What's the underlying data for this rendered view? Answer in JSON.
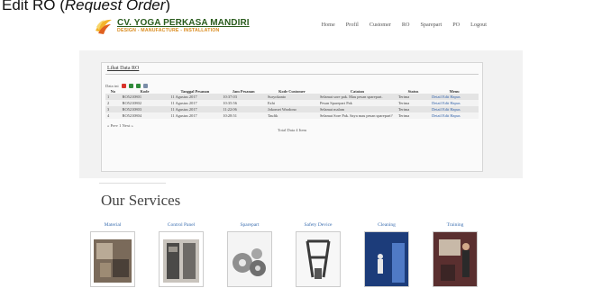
{
  "caption": {
    "prefix": "Edit RO (",
    "emphasis": "Request Order",
    "suffix": ")"
  },
  "header": {
    "company": "CV. YOGA PERKASA MANDIRI",
    "tagline": "DESIGN - MANUFACTURE - INSTALLATION",
    "nav": [
      "Home",
      "Profil",
      "Customer",
      "RO",
      "Sparepart",
      "PO",
      "Logout"
    ]
  },
  "panel": {
    "title": "Lihat Data RO",
    "export_label": "Data ini",
    "columns": [
      "No",
      "Kode",
      "Tanggal Pesanan",
      "Jam Pesanan",
      "Kode Customer",
      "Catatan",
      "Status",
      "Menu"
    ],
    "rows": [
      {
        "no": "1",
        "kode": "RO5210801",
        "tanggal": "11 Agustus 2017",
        "jam": "10:37:03",
        "customer": "Suryokanto",
        "catatan": "Selamat sore pak. Mau pesan sparepart.",
        "status": "Terima",
        "menu": "Detail Edit Hapus"
      },
      {
        "no": "2",
        "kode": "RO5210802",
        "tanggal": "11 Agustus 2017",
        "jam": "10:35:56",
        "customer": "Ezhi",
        "catatan": "Pesan Sparepart Pak",
        "status": "Terima",
        "menu": "Detail Edit Hapus"
      },
      {
        "no": "3",
        "kode": "RO5210803",
        "tanggal": "11 Agustus 2017",
        "jam": "11:22:06",
        "customer": "Jokomei Wardono",
        "catatan": "Selamat malam",
        "status": "Terima",
        "menu": "Detail Edit Hapus"
      },
      {
        "no": "4",
        "kode": "RO5210804",
        "tanggal": "11 Agustus 2017",
        "jam": "10:28:51",
        "customer": "Taufik",
        "catatan": "Selamat Sore Pak. Saya mau pesan sparepart?",
        "status": "Terima",
        "menu": "Detail Edit Hapus"
      }
    ],
    "pager": "« Prev 1 Next »",
    "total": "Total Data 4 Item"
  },
  "services": {
    "title": "Our Services",
    "items": [
      "Material",
      "Control Panel",
      "Sparepart",
      "Safety Device",
      "Cleaning",
      "Training"
    ]
  }
}
